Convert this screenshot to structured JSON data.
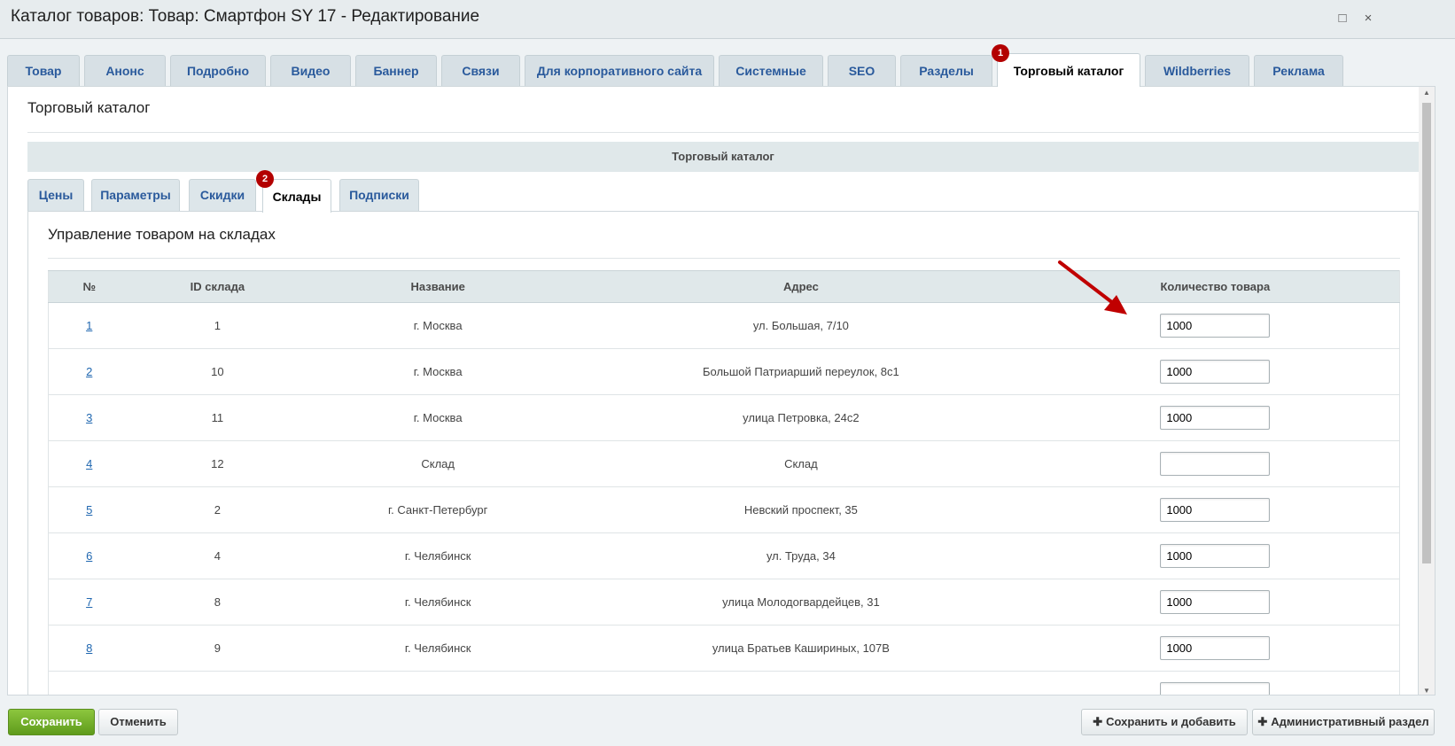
{
  "window": {
    "title": "Каталог товаров: Товар: Смартфон SY 17 - Редактирование",
    "maximize_icon": "□",
    "close_icon": "×"
  },
  "top_tabs": [
    {
      "label": "Товар"
    },
    {
      "label": "Анонс"
    },
    {
      "label": "Подробно"
    },
    {
      "label": "Видео"
    },
    {
      "label": "Баннер"
    },
    {
      "label": "Связи"
    },
    {
      "label": "Для корпоративного сайта"
    },
    {
      "label": "Системные"
    },
    {
      "label": "SEO"
    },
    {
      "label": "Разделы"
    },
    {
      "label": "Торговый каталог"
    },
    {
      "label": "Wildberries"
    },
    {
      "label": "Реклама"
    }
  ],
  "badges": {
    "one": "1",
    "two": "2"
  },
  "section": {
    "title": "Торговый каталог",
    "subheader": "Торговый каталог"
  },
  "sub_tabs": [
    {
      "label": "Цены"
    },
    {
      "label": "Параметры"
    },
    {
      "label": "Скидки"
    },
    {
      "label": "Склады"
    },
    {
      "label": "Подписки"
    }
  ],
  "warehouses": {
    "title": "Управление товаром на складах",
    "columns": [
      "№",
      "ID склада",
      "Название",
      "Адрес",
      "Количество товара"
    ],
    "rows": [
      {
        "num": "1",
        "id": "1",
        "name": "г. Москва",
        "address": "ул. Большая, 7/10",
        "qty": "1000"
      },
      {
        "num": "2",
        "id": "10",
        "name": "г. Москва",
        "address": "Большой Патриарший переулок, 8с1",
        "qty": "1000"
      },
      {
        "num": "3",
        "id": "11",
        "name": "г. Москва",
        "address": "улица Петровка, 24с2",
        "qty": "1000"
      },
      {
        "num": "4",
        "id": "12",
        "name": "Склад",
        "address": "Склад",
        "qty": ""
      },
      {
        "num": "5",
        "id": "2",
        "name": "г. Санкт-Петербург",
        "address": "Невский проспект, 35",
        "qty": "1000"
      },
      {
        "num": "6",
        "id": "4",
        "name": "г. Челябинск",
        "address": "ул. Труда, 34",
        "qty": "1000"
      },
      {
        "num": "7",
        "id": "8",
        "name": "г. Челябинск",
        "address": "улица Молодогвардейцев, 31",
        "qty": "1000"
      },
      {
        "num": "8",
        "id": "9",
        "name": "г. Челябинск",
        "address": "улица Братьев Кашириных, 107В",
        "qty": "1000"
      }
    ]
  },
  "footer": {
    "save": "Сохранить",
    "cancel": "Отменить",
    "save_add": "Сохранить и добавить",
    "admin_section": "Административный раздел"
  },
  "colors": {
    "accent": "#5f9b1c",
    "badge": "#b30000",
    "annotation_arrow": "#c00000",
    "link": "#2067b0"
  }
}
